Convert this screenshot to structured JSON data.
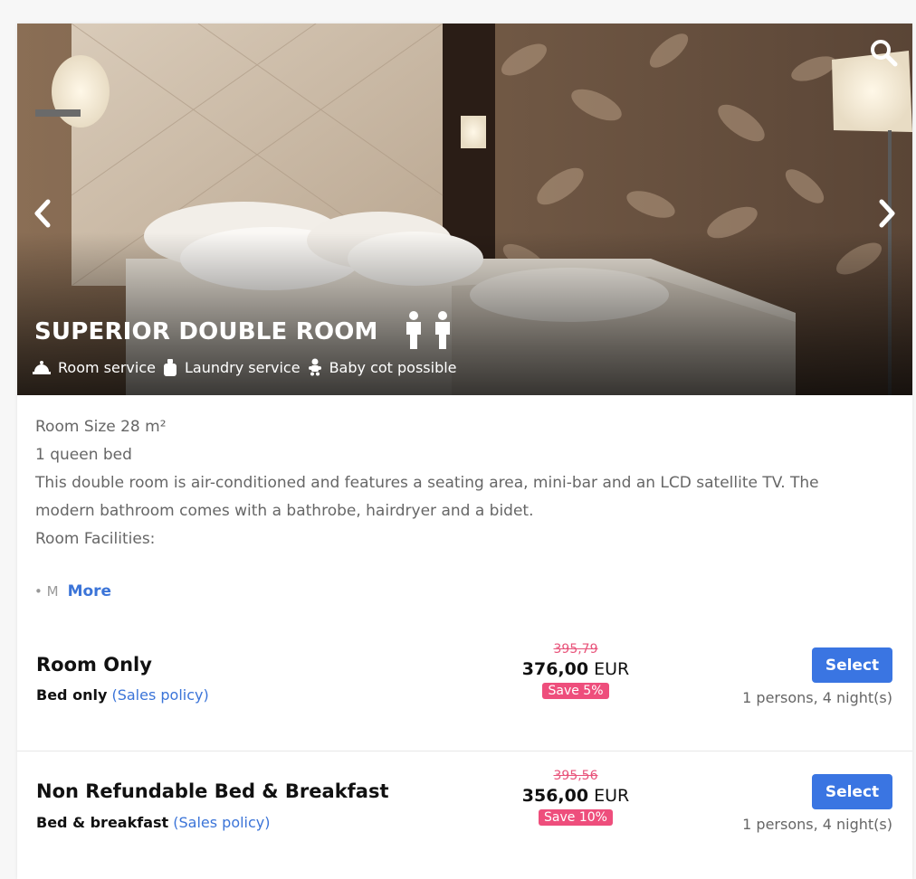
{
  "room": {
    "title": "SUPERIOR DOUBLE ROOM",
    "amenities": [
      {
        "icon": "bell-icon",
        "label": "Room service"
      },
      {
        "icon": "laundry-icon",
        "label": "Laundry service"
      },
      {
        "icon": "baby-icon",
        "label": "Baby cot possible"
      }
    ],
    "occupancy_icon": "two-persons-icon",
    "description": {
      "size": "Room Size 28 m²",
      "bed": "1 queen bed",
      "text": "This double room is air-conditioned and features a seating area, mini-bar and an LCD satellite TV. The modern bathroom comes with a bathrobe, hairdryer and a bidet.",
      "facilities": "Room Facilities:",
      "truncated": "• M",
      "more_label": "More"
    }
  },
  "rates": [
    {
      "name": "Room Only",
      "board": "Bed only",
      "policy": "(Sales policy)",
      "old_price": "395,79",
      "price": "376,00",
      "currency": "EUR",
      "save": "Save 5%",
      "select_label": "Select",
      "persons": "1 persons, 4 night(s)"
    },
    {
      "name": "Non Refundable Bed & Breakfast",
      "board": "Bed & breakfast",
      "policy": "(Sales policy)",
      "old_price": "395,56",
      "price": "356,00",
      "currency": "EUR",
      "save": "Save 10%",
      "select_label": "Select",
      "persons": "1 persons, 4 night(s)"
    }
  ],
  "colors": {
    "accent": "#3a75e2",
    "link": "#3b74d8",
    "sale": "#ee4e7c"
  }
}
